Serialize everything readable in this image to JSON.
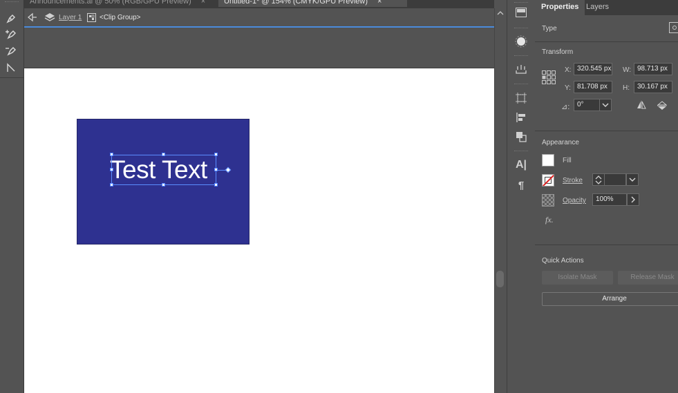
{
  "document_tabs": [
    {
      "title": "Announcements.ai @ 50% (RGB/GPU Preview)",
      "close": "×"
    },
    {
      "title": "Untitled-1* @ 154% (CMYK/GPU Preview)",
      "close": "×"
    }
  ],
  "isolation": {
    "layer": "Layer 1",
    "group": "<Clip Group>"
  },
  "canvas": {
    "text_object": "Test Text"
  },
  "panel": {
    "tabs": [
      "Properties",
      "Layers"
    ],
    "type_section": "Type",
    "transform": {
      "title": "Transform",
      "x_label": "X:",
      "x_value": "320.545 px",
      "y_label": "Y:",
      "y_value": "81.708 px",
      "w_label": "W:",
      "w_value": "98.713 px",
      "h_label": "H:",
      "h_value": "30.167 px",
      "angle_label": "⊿:",
      "angle_value": "0°"
    },
    "appearance": {
      "title": "Appearance",
      "fill_label": "Fill",
      "stroke_label": "Stroke",
      "opacity_label": "Opacity",
      "opacity_value": "100%",
      "fx_label": "fx."
    },
    "quick_actions": {
      "title": "Quick Actions",
      "isolate_mask": "Isolate Mask",
      "release_mask": "Release Mask",
      "arrange": "Arrange"
    }
  },
  "colors": {
    "artboard_fill": "#2e3190",
    "selection": "#5a8dff",
    "isolation_line": "#4a8bdc",
    "panel_bg": "#535353"
  }
}
